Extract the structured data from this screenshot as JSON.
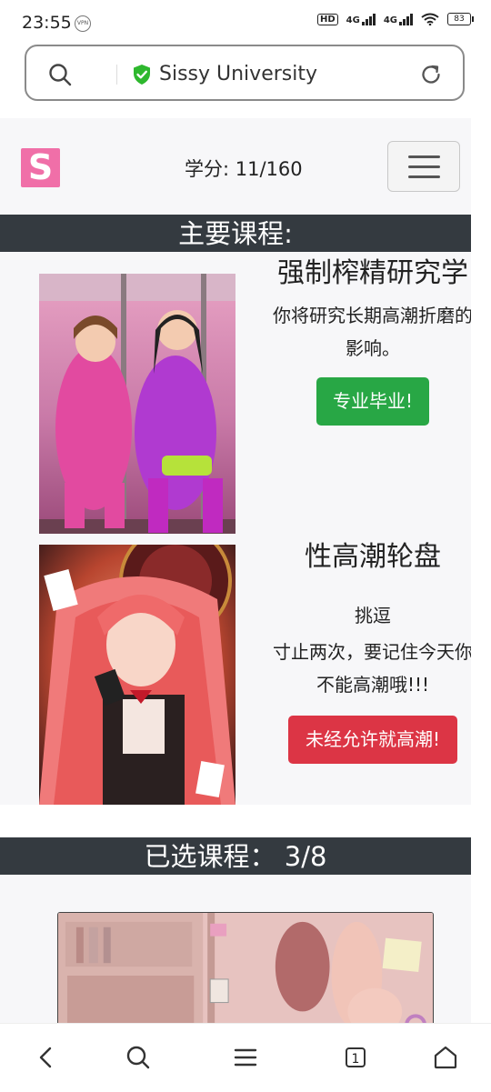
{
  "status_bar": {
    "time": "23:55",
    "vpn": "VPN",
    "hd": "HD",
    "net1": "4G",
    "net2": "4G",
    "battery": "83"
  },
  "address_bar": {
    "url_text": "Sissy University"
  },
  "navbar": {
    "logo_letter": "S",
    "credits": "学分: 11/160"
  },
  "sections": {
    "main_courses": "主要课程:",
    "selected_courses": "已选课程：  3/8"
  },
  "courses": [
    {
      "title": "强制榨精研究学",
      "description": "你将研究长期高潮折磨的影响。",
      "button": "专业毕业!"
    },
    {
      "title": "性高潮轮盘",
      "subtitle": "挑逗",
      "description": "寸止两次，要记住今天你不能高潮哦!!!",
      "button": "未经允许就高潮!"
    }
  ],
  "bottom_bar": {
    "tab_count": "1"
  },
  "icons": [
    "search-icon",
    "shield-check-icon",
    "reload-icon",
    "back-icon",
    "search-icon",
    "menu-icon",
    "tabs-icon",
    "home-icon",
    "hamburger-icon"
  ],
  "colors": {
    "section_bar": "#343a40",
    "button_green": "#28a745",
    "button_red": "#dc3545",
    "logo_pink": "#f06fa8",
    "shield_green": "#2eb82e"
  }
}
